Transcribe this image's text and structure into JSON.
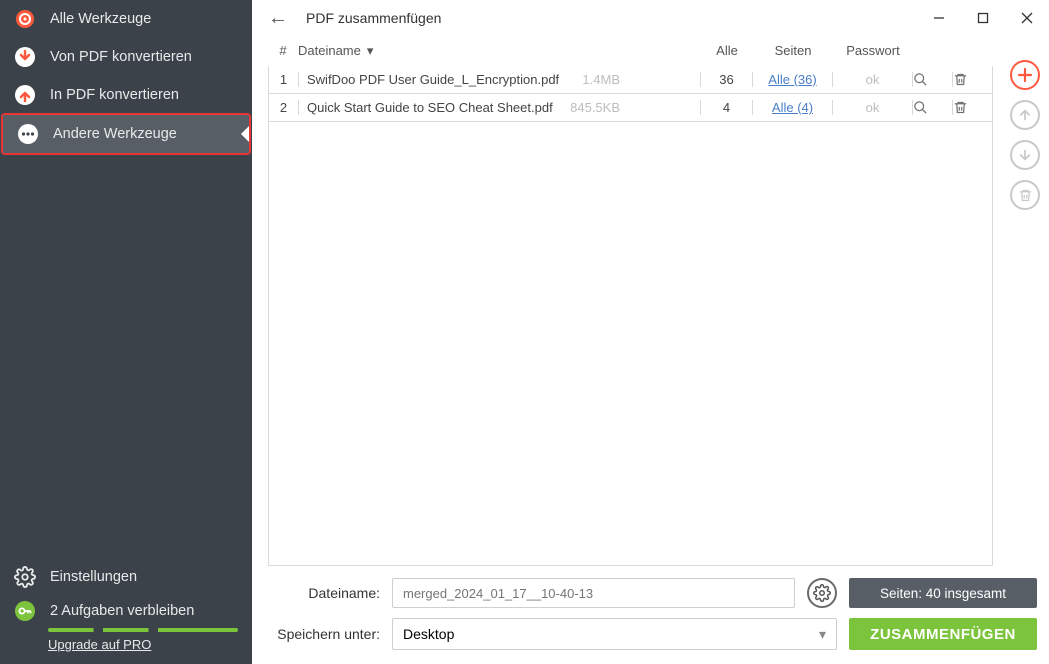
{
  "sidebar": {
    "items": [
      {
        "label": "Alle Werkzeuge",
        "icon": "target"
      },
      {
        "label": "Von PDF konvertieren",
        "icon": "down"
      },
      {
        "label": "In PDF konvertieren",
        "icon": "up"
      },
      {
        "label": "Andere Werkzeuge",
        "icon": "more"
      }
    ],
    "settings_label": "Einstellungen",
    "tasks_remaining": "2 Aufgaben verbleiben",
    "upgrade_label": "Upgrade auf PRO"
  },
  "header": {
    "title": "PDF zusammenfügen"
  },
  "table": {
    "columns": {
      "num": "#",
      "name": "Dateiname",
      "all": "Alle",
      "pages": "Seiten",
      "password": "Passwort"
    },
    "rows": [
      {
        "idx": "1",
        "name": "SwifDoo PDF User Guide_L_Encryption.pdf",
        "size": "1.4MB",
        "all": "36",
        "pages": "Alle (36)",
        "password": "ok"
      },
      {
        "idx": "2",
        "name": "Quick Start Guide to SEO Cheat Sheet.pdf",
        "size": "845.5KB",
        "all": "4",
        "pages": "Alle (4)",
        "password": "ok"
      }
    ]
  },
  "bottom": {
    "filename_label": "Dateiname:",
    "filename_placeholder": "merged_2024_01_17__10-40-13",
    "pages_total": "Seiten: 40 insgesamt",
    "save_label": "Speichern unter:",
    "save_location": "Desktop",
    "merge_button": "ZUSAMMENFÜGEN"
  }
}
